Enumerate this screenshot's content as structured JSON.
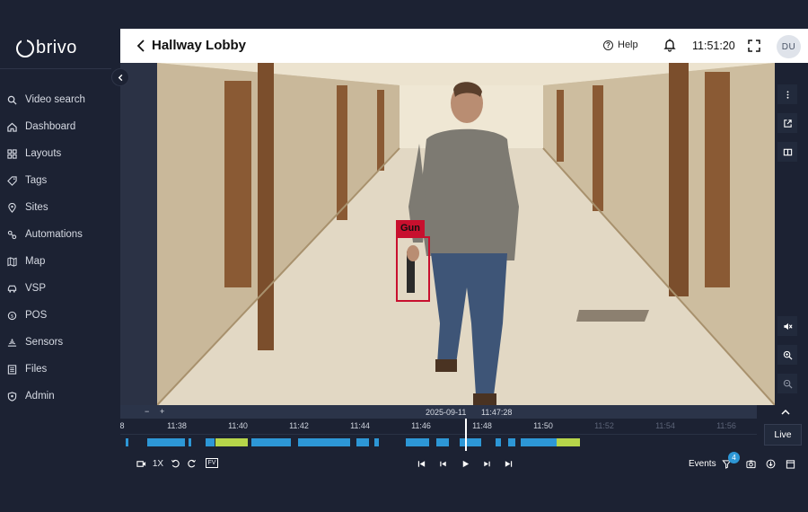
{
  "brand": {
    "name": "brivo"
  },
  "sidebar": {
    "items": [
      {
        "label": "Video search",
        "icon": "search-icon"
      },
      {
        "label": "Dashboard",
        "icon": "home-icon"
      },
      {
        "label": "Layouts",
        "icon": "layout-icon"
      },
      {
        "label": "Tags",
        "icon": "tag-icon"
      },
      {
        "label": "Sites",
        "icon": "location-pin-icon"
      },
      {
        "label": "Automations",
        "icon": "automation-icon"
      },
      {
        "label": "Map",
        "icon": "map-icon"
      },
      {
        "label": "VSP",
        "icon": "vehicle-icon"
      },
      {
        "label": "POS",
        "icon": "pos-icon"
      },
      {
        "label": "Sensors",
        "icon": "sensor-icon"
      },
      {
        "label": "Files",
        "icon": "files-icon"
      },
      {
        "label": "Admin",
        "icon": "admin-shield-icon"
      }
    ]
  },
  "header": {
    "title": "Hallway Lobby",
    "help_label": "Help",
    "clock": "11:51:20",
    "avatar_initials": "DU"
  },
  "video": {
    "detection_label": "Gun",
    "detection_color": "#c8102e"
  },
  "timeline": {
    "zoom_minus": "−",
    "zoom_plus": "+",
    "date": "2025-09-11",
    "time": "11:47:28",
    "ticks": [
      {
        "label": "8",
        "future": false
      },
      {
        "label": "11:38",
        "future": false
      },
      {
        "label": "11:40",
        "future": false
      },
      {
        "label": "11:42",
        "future": false
      },
      {
        "label": "11:44",
        "future": false
      },
      {
        "label": "11:46",
        "future": false
      },
      {
        "label": "11:48",
        "future": false
      },
      {
        "label": "11:50",
        "future": false
      },
      {
        "label": "11:52",
        "future": true
      },
      {
        "label": "11:54",
        "future": true
      },
      {
        "label": "11:56",
        "future": true
      }
    ],
    "live_label": "Live",
    "accent_color": "#2d97d6",
    "highlight_color": "#b6d54a"
  },
  "controls": {
    "speed": "1X",
    "fv_label": "FV",
    "events_label": "Events",
    "events_count": "4"
  }
}
